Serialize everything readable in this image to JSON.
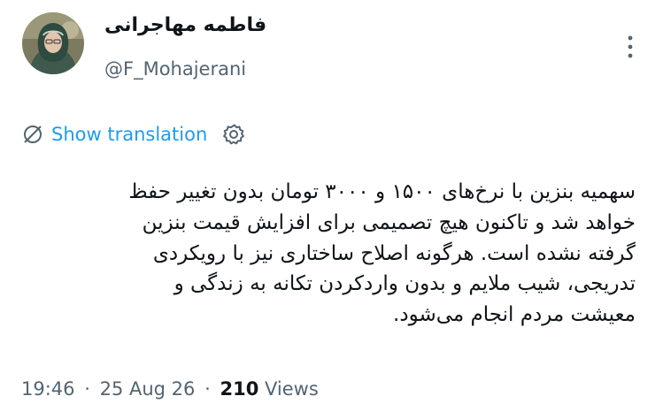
{
  "author": {
    "display_name": "فاطمه مهاجرانی",
    "handle": "@F_Mohajerani"
  },
  "translate": {
    "label": "Show translation",
    "icon": "translate-slash-icon",
    "settings_icon": "gear-icon"
  },
  "tweet": {
    "lines": [
      "سهمیه بنزین با نرخ‌های ۱۵۰۰ و ۳۰۰۰ تومان بدون تغییر حفظ",
      "خواهد شد و تاکنون هیچ تصمیمی برای افزایش قیمت بنزین",
      "گرفته نشده است. هرگونه اصلاح ساختاری نیز با رویکردی",
      "تدریجی، شیب ملایم و بدون واردکردن تکانه به زندگی و",
      "معیشت مردم انجام می‌شود."
    ]
  },
  "meta": {
    "time": "19:46",
    "separator": "·",
    "date": "25 Aug 26",
    "views_count": "210",
    "views_label": "Views"
  },
  "colors": {
    "link": "#1d9bf0",
    "secondary": "#536471",
    "text": "#0f1419"
  }
}
